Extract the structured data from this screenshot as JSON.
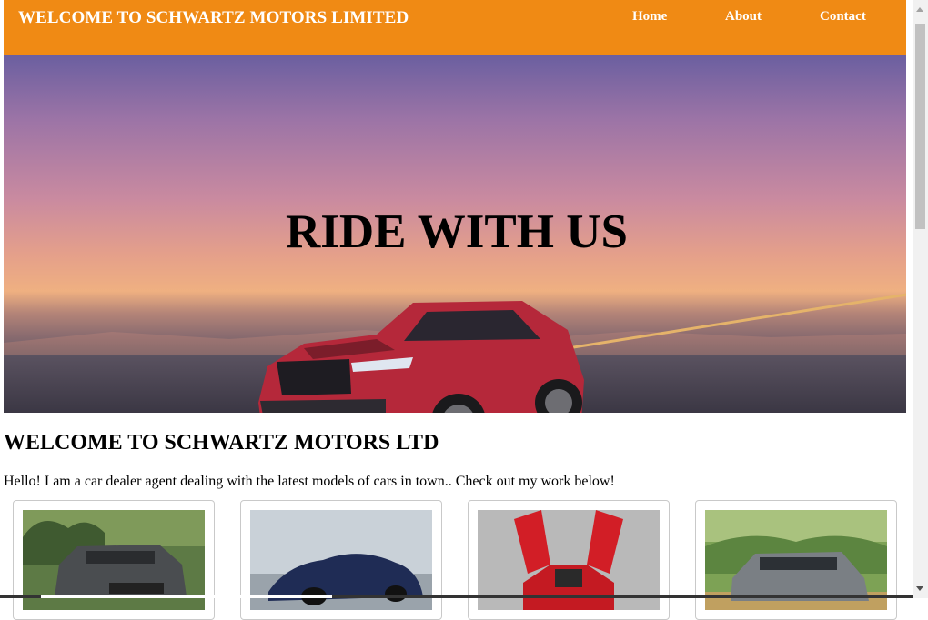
{
  "header": {
    "brand": "WELCOME TO SCHWARTZ MOTORS LIMITED",
    "nav": [
      {
        "label": "Home"
      },
      {
        "label": "About"
      },
      {
        "label": "Contact"
      }
    ],
    "background": "#f08a14"
  },
  "hero": {
    "title": "RIDE WITH US",
    "image": "red-suv-on-road-at-sunset"
  },
  "section": {
    "title": "WELCOME TO SCHWARTZ MOTORS LTD",
    "intro": "Hello! I am a car dealer agent dealing with the latest models of cars in town.. Check out my work below!"
  },
  "cards": [
    {
      "image": "dark-gray-suv-photo"
    },
    {
      "image": "navy-blue-sports-car-photo"
    },
    {
      "image": "red-supercar-doors-open-photo"
    },
    {
      "image": "gray-crossover-suv-photo"
    }
  ]
}
